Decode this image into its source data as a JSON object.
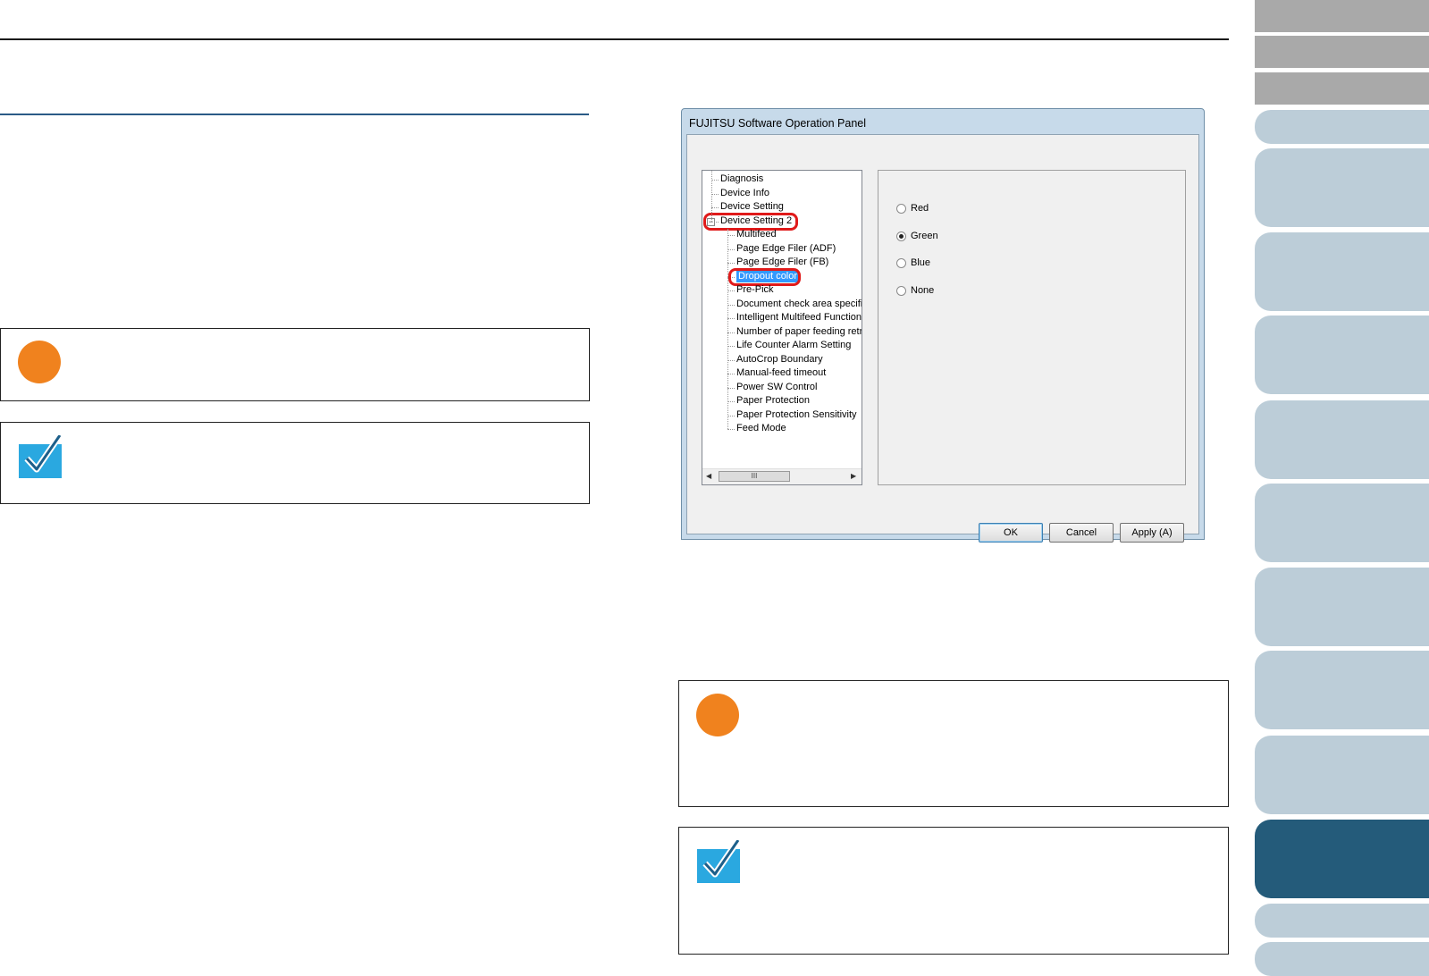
{
  "dialog": {
    "title": "FUJITSU Software Operation Panel",
    "tree": [
      {
        "label": "Diagnosis",
        "level": 0
      },
      {
        "label": "Device Info",
        "level": 0
      },
      {
        "label": "Device Setting",
        "level": 0
      },
      {
        "label": "Device Setting 2",
        "level": 0,
        "expander": "−",
        "highlight": true
      },
      {
        "label": "Multifeed",
        "level": 1
      },
      {
        "label": "Page Edge Filer (ADF)",
        "level": 1
      },
      {
        "label": "Page Edge Filer (FB)",
        "level": 1
      },
      {
        "label": "Dropout color",
        "level": 1,
        "selected": true,
        "highlight": true
      },
      {
        "label": "Pre-Pick",
        "level": 1
      },
      {
        "label": "Document check area specific",
        "level": 1
      },
      {
        "label": "Intelligent Multifeed Function",
        "level": 1
      },
      {
        "label": "Number of paper feeding retries",
        "level": 1
      },
      {
        "label": "Life Counter Alarm Setting",
        "level": 1
      },
      {
        "label": "AutoCrop Boundary",
        "level": 1
      },
      {
        "label": "Manual-feed timeout",
        "level": 1
      },
      {
        "label": "Power SW Control",
        "level": 1
      },
      {
        "label": "Paper Protection",
        "level": 1
      },
      {
        "label": "Paper Protection Sensitivity",
        "level": 1
      },
      {
        "label": "Feed Mode",
        "level": 1
      }
    ],
    "scroll_thumb_label": "III",
    "options": [
      {
        "label": "Red",
        "selected": false
      },
      {
        "label": "Green",
        "selected": true
      },
      {
        "label": "Blue",
        "selected": false
      },
      {
        "label": "None",
        "selected": false
      }
    ],
    "buttons": {
      "ok": "OK",
      "cancel": "Cancel",
      "apply": "Apply (A)"
    }
  },
  "colors": {
    "accent": "#245b7a",
    "tab": "#bccdd8",
    "attention": "#f0821e",
    "hint": "#2aa8e0",
    "highlight_ring": "#e01a1a"
  },
  "icons": {
    "attention": "attention-icon",
    "hint": "hint-check-icon"
  }
}
